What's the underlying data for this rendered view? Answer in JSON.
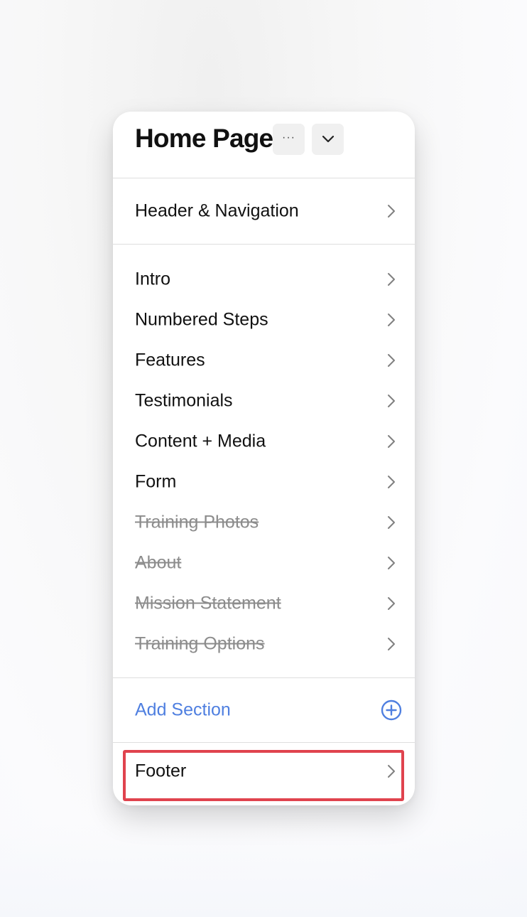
{
  "page": {
    "title": "Home Page",
    "more_button": "···"
  },
  "navigation": {
    "header_nav": "Header & Navigation"
  },
  "sections": [
    {
      "label": "Intro",
      "hidden": false
    },
    {
      "label": "Numbered Steps",
      "hidden": false
    },
    {
      "label": "Features",
      "hidden": false
    },
    {
      "label": "Testimonials",
      "hidden": false
    },
    {
      "label": "Content + Media",
      "hidden": false
    },
    {
      "label": "Form",
      "hidden": false
    },
    {
      "label": "Training Photos",
      "hidden": true
    },
    {
      "label": "About",
      "hidden": true
    },
    {
      "label": "Mission Statement",
      "hidden": true
    },
    {
      "label": "Training Options",
      "hidden": true
    }
  ],
  "add_section": {
    "label": "Add Section",
    "icon": "plus-circle-icon"
  },
  "footer": {
    "label": "Footer",
    "highlighted": true
  },
  "colors": {
    "accent": "#4f7fe0",
    "highlight": "#e0434e",
    "hidden_text": "#8c8c8c",
    "chevron": "#808080"
  }
}
